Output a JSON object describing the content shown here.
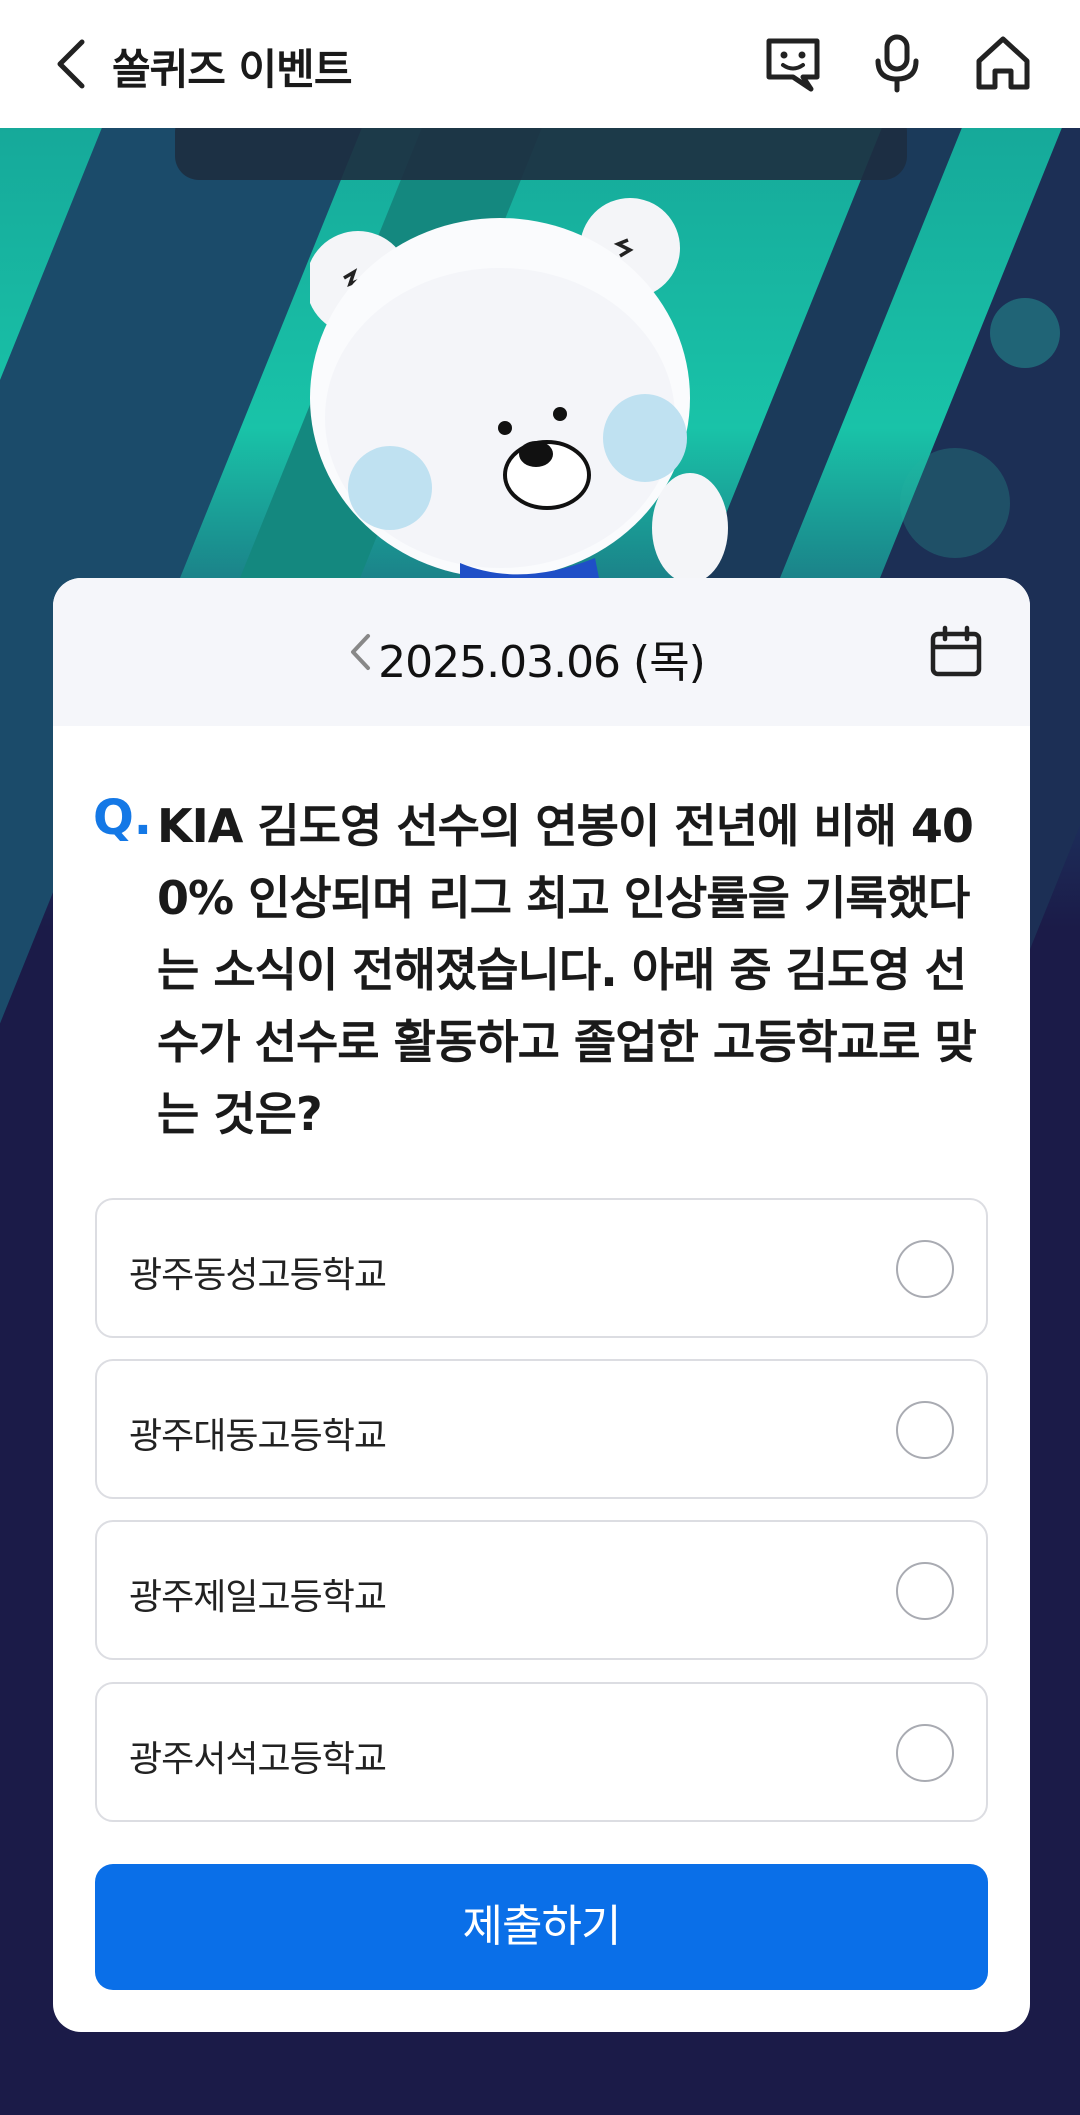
{
  "header": {
    "title": "쏠퀴즈 이벤트",
    "icons": [
      "back-arrow-icon",
      "chatbot-icon",
      "microphone-icon",
      "home-icon"
    ]
  },
  "date_bar": {
    "date": "2025.03.06 (목)",
    "icons": [
      "chevron-left-icon",
      "calendar-icon"
    ]
  },
  "question": {
    "prefix": "Q.",
    "text": "KIA 김도영 선수의 연봉이 전년에 비해 400% 인상되며 리그 최고 인상률을 기록했다는 소식이 전해졌습니다. 아래 중 김도영 선수가 선수로 활동하고 졸업한 고등학교로 맞는 것은?"
  },
  "options": [
    {
      "label": "광주동성고등학교"
    },
    {
      "label": "광주대동고등학교"
    },
    {
      "label": "광주제일고등학교"
    },
    {
      "label": "광주서석고등학교"
    }
  ],
  "submit_label": "제출하기",
  "colors": {
    "accent": "#0a6fe8",
    "question_mark": "#1478e6",
    "page_bg": "#1b1b48",
    "hero_teal": "#19c3a8"
  }
}
